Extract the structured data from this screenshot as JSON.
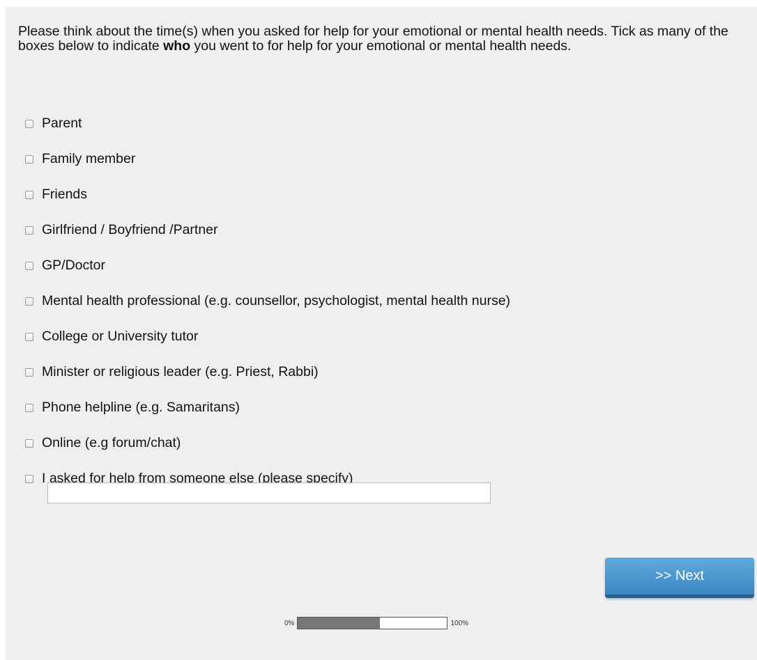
{
  "question": {
    "text_before": "Please think about the time(s) when you asked for help for your emotional or mental health needs. Tick as many of the boxes below to indicate ",
    "emphasis": "who",
    "text_after": " you went to for help for your emotional or mental health needs."
  },
  "options": [
    {
      "label": "Parent",
      "checked": false
    },
    {
      "label": "Family member",
      "checked": false
    },
    {
      "label": "Friends",
      "checked": false
    },
    {
      "label": "Girlfriend / Boyfriend /Partner",
      "checked": false
    },
    {
      "label": "GP/Doctor",
      "checked": false
    },
    {
      "label": "Mental health professional (e.g. counsellor, psychologist, mental health nurse)",
      "checked": false
    },
    {
      "label": "College or University tutor",
      "checked": false
    },
    {
      "label": "Minister or religious leader (e.g. Priest, Rabbi)",
      "checked": false
    },
    {
      "label": "Phone helpline (e.g. Samaritans)",
      "checked": false
    },
    {
      "label": "Online (e.g forum/chat)",
      "checked": false
    },
    {
      "label": "I asked for help from someone else (please specify)",
      "checked": false
    }
  ],
  "other_specify": {
    "value": ""
  },
  "navigation": {
    "next_label": ">> Next"
  },
  "progress": {
    "start_label": "0%",
    "end_label": "100%",
    "fraction": 0.55
  },
  "colors": {
    "panel_background": "#efefef",
    "button_accent": "#4a97d0",
    "progress_fill": "#777777"
  }
}
